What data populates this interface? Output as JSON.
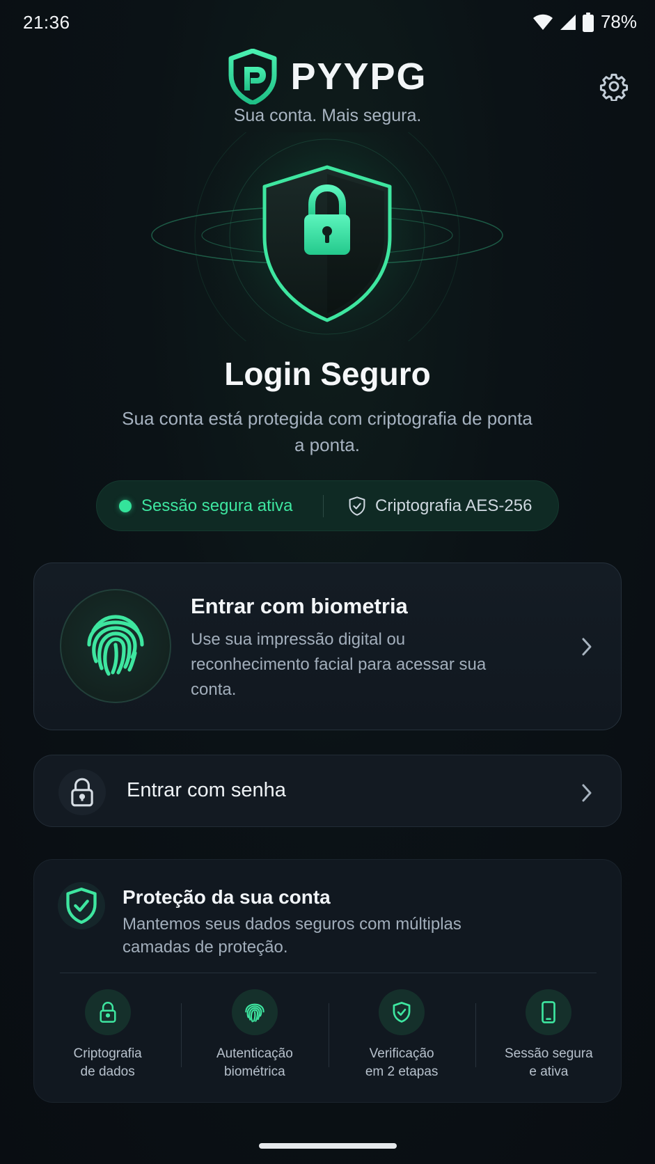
{
  "status_bar": {
    "time": "21:36",
    "battery": "78%"
  },
  "header": {
    "brand": "PYYPG",
    "tagline": "Sua conta. Mais segura.",
    "settings_icon": "gear-icon"
  },
  "hero": {
    "title": "Login Seguro",
    "subtitle": "Sua conta está protegida com criptografia de ponta a ponta."
  },
  "session": {
    "status": "Sessão segura ativa",
    "encryption": "Criptografia AES-256"
  },
  "biometric": {
    "title": "Entrar com biometria",
    "description": "Use sua impressão digital ou reconhecimento facial para acessar sua conta.",
    "icon": "fingerprint-icon"
  },
  "password": {
    "label": "Entrar com senha",
    "icon": "lock-icon"
  },
  "protection": {
    "title": "Proteção da sua conta",
    "description": "Mantemos seus dados seguros com múltiplas camadas de proteção.",
    "features": [
      {
        "line1": "Criptografia",
        "line2": "de dados",
        "icon": "lock-icon"
      },
      {
        "line1": "Autenticação",
        "line2": "biométrica",
        "icon": "fingerprint-icon"
      },
      {
        "line1": "Verificação",
        "line2": "em 2 etapas",
        "icon": "shield-check-icon"
      },
      {
        "line1": "Sessão segura",
        "line2": "e ativa",
        "icon": "phone-icon"
      }
    ]
  },
  "colors": {
    "accent": "#3ee6a0",
    "background": "#0a0f14",
    "card": "#131a22"
  }
}
